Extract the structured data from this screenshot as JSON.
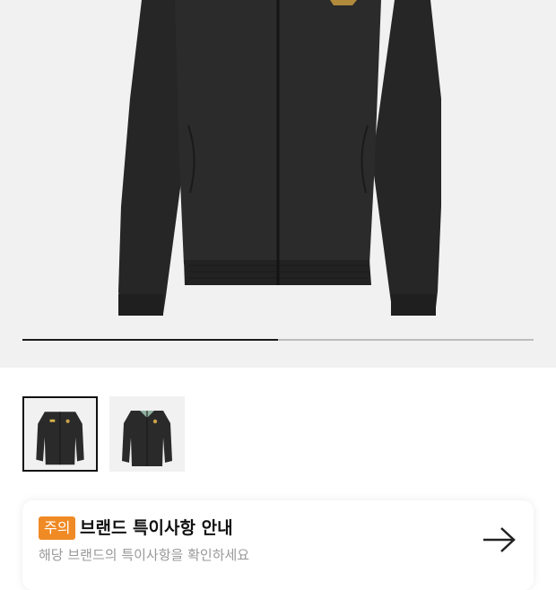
{
  "gallery": {
    "image_alt": "black track jacket",
    "progress": 0.5,
    "thumbnails": [
      {
        "alt": "jacket front",
        "selected": true
      },
      {
        "alt": "jacket front alternate",
        "selected": false
      }
    ]
  },
  "notice": {
    "badge": "주의",
    "title": "브랜드 특이사항 안내",
    "subtitle": "해당 브랜드의 특이사항을 확인하세요",
    "arrow_icon": "arrow-right-icon"
  },
  "colors": {
    "accent": "#f08a24",
    "jacket": "#2a2a2a",
    "background": "#f1f1f1"
  }
}
